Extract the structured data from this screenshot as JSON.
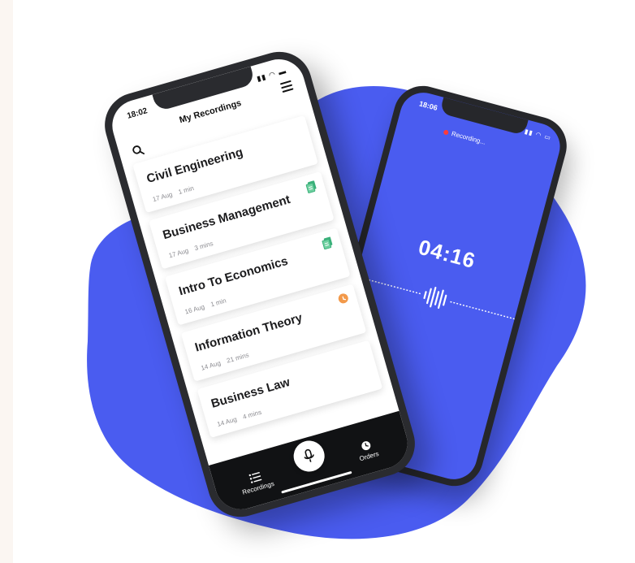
{
  "colors": {
    "accent": "#4a5cf0",
    "recording_dot": "#ff3b3b",
    "doc_icon": "#3ab07a",
    "clock_icon": "#f2994a",
    "tabbar": "#111214"
  },
  "front_phone": {
    "time": "18:02",
    "title": "My Recordings",
    "recordings": [
      {
        "name": "Civil Engineering",
        "date": "17 Aug",
        "duration": "1 min",
        "icon": ""
      },
      {
        "name": "Business Management",
        "date": "17 Aug",
        "duration": "3 mins",
        "icon": "document-icon"
      },
      {
        "name": "Intro To Economics",
        "date": "16 Aug",
        "duration": "1 min",
        "icon": "document-icon"
      },
      {
        "name": "Information Theory",
        "date": "14 Aug",
        "duration": "21 mins",
        "icon": "clock-icon"
      },
      {
        "name": "Business Law",
        "date": "14 Aug",
        "duration": "4 mins",
        "icon": ""
      }
    ],
    "tabs": {
      "recordings_label": "Recordings",
      "orders_label": "Orders"
    }
  },
  "back_phone": {
    "time": "18:06",
    "status": "Recording...",
    "timer": "04:16"
  }
}
